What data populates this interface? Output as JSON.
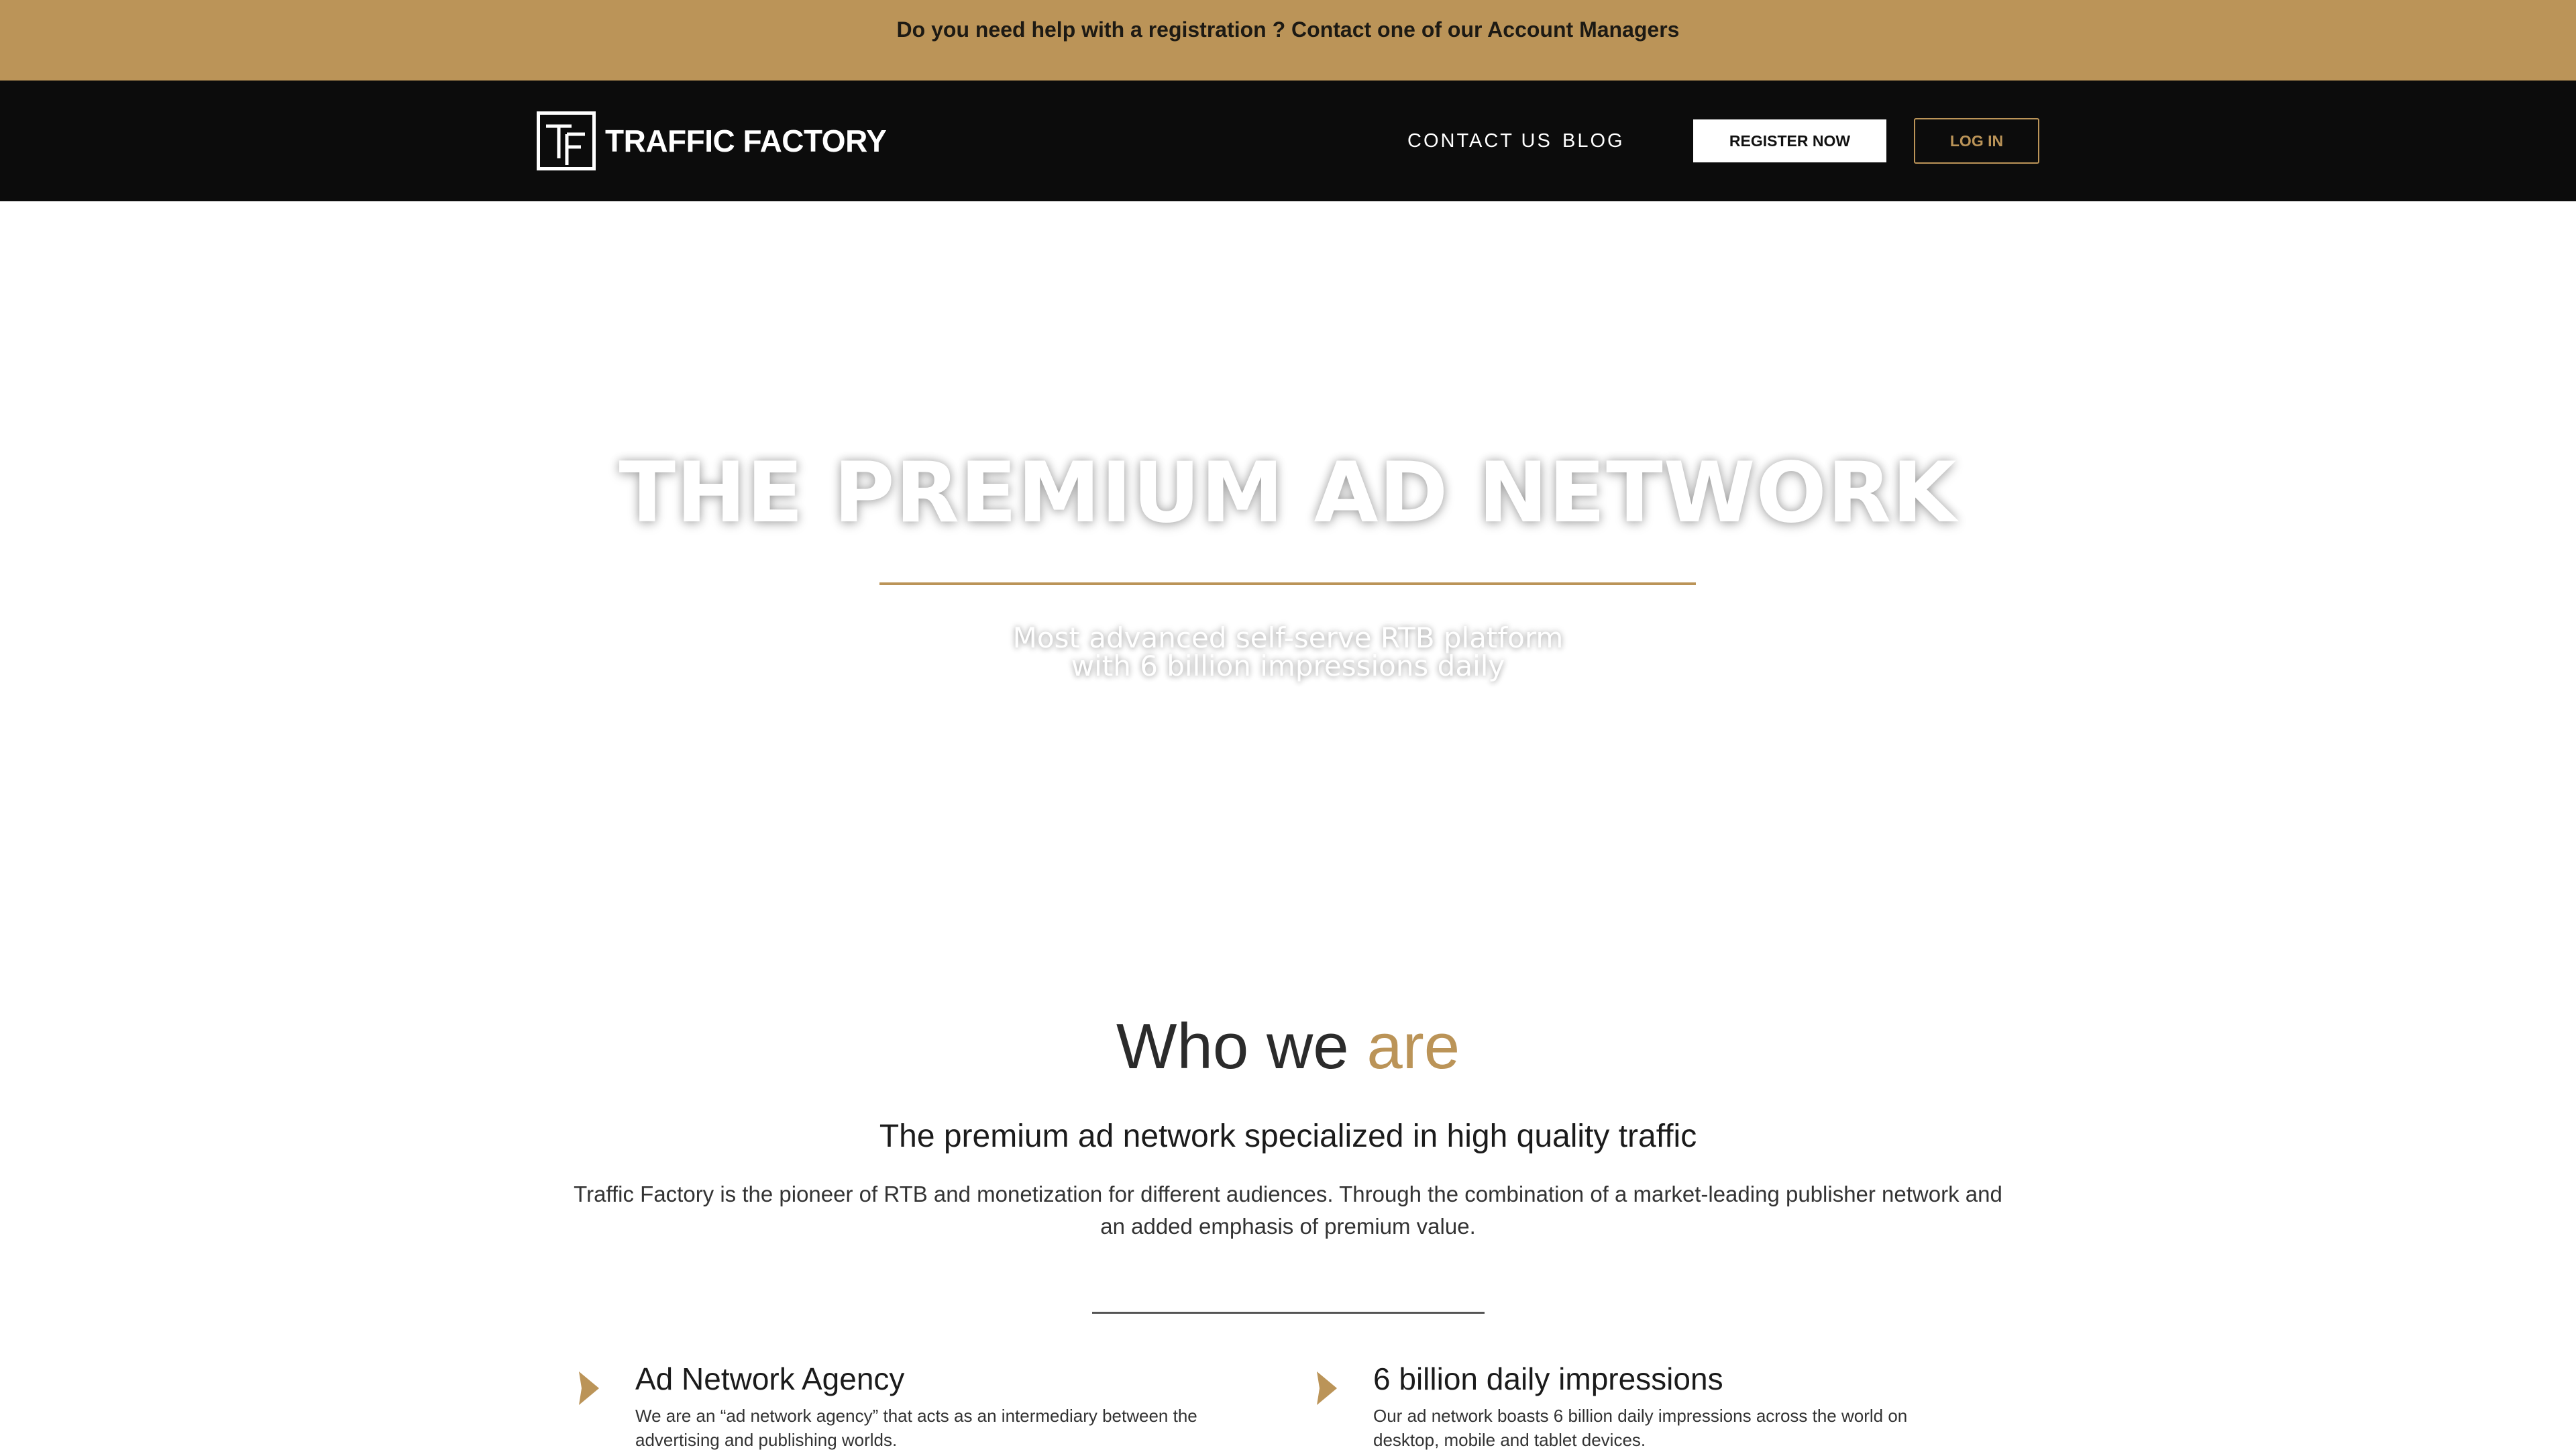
{
  "announcement": {
    "text": "Do you need help with a registration ? Contact one of our Account Managers"
  },
  "header": {
    "logo_text": "TRAFFIC FACTORY",
    "nav": [
      {
        "label": "CONTACT US"
      },
      {
        "label": "BLOG"
      }
    ],
    "register_label": "REGISTER NOW",
    "login_label": "LOG IN"
  },
  "hero": {
    "title": "THE PREMIUM AD NETWORK",
    "subtitle_line1": "Most advanced self-serve RTB platform",
    "subtitle_line2": "with 6 billion impressions daily"
  },
  "who": {
    "title_part1": "Who we",
    "title_part2": "are",
    "subtitle": "The premium ad network specialized in high quality traffic",
    "body": "Traffic Factory is the pioneer of RTB and monetization for different audiences. Through the combination of a market-leading publisher network and an added emphasis of premium value."
  },
  "features": [
    {
      "title": "Ad Network Agency",
      "description": "We are an “ad network agency” that acts as an intermediary between the advertising and publishing worlds."
    },
    {
      "title": "6 billion daily impressions",
      "description": "Our ad network boasts 6 billion daily impressions across the world on desktop, mobile and tablet devices."
    }
  ],
  "colors": {
    "accent": "#bb9458",
    "navbar": "#0c0c0c",
    "announcement_bg": "#bb9458"
  },
  "icons": {
    "logo": "tf-monogram-icon",
    "feature_bullet": "triangle-right-icon"
  }
}
